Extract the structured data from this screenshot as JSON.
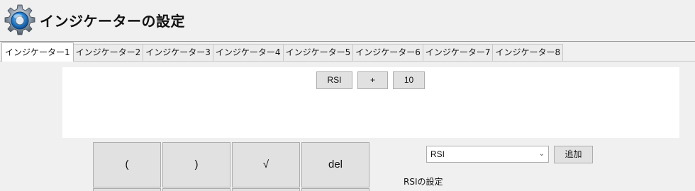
{
  "window": {
    "title": "インジケーターの設定",
    "icon": "gear-icon"
  },
  "tabs": [
    {
      "label": "インジケーター1",
      "active": true
    },
    {
      "label": "インジケーター2",
      "active": false
    },
    {
      "label": "インジケーター3",
      "active": false
    },
    {
      "label": "インジケーター4",
      "active": false
    },
    {
      "label": "インジケーター5",
      "active": false
    },
    {
      "label": "インジケーター6",
      "active": false
    },
    {
      "label": "インジケーター7",
      "active": false
    },
    {
      "label": "インジケーター8",
      "active": false
    }
  ],
  "expression": {
    "tokens": [
      "RSI",
      "+",
      "10"
    ]
  },
  "keypad": {
    "keys": [
      "(",
      ")",
      "√",
      "del"
    ]
  },
  "indicator_select": {
    "value": "RSI"
  },
  "add_button": {
    "label": "追加"
  },
  "settings": {
    "label": "RSIの設定"
  }
}
